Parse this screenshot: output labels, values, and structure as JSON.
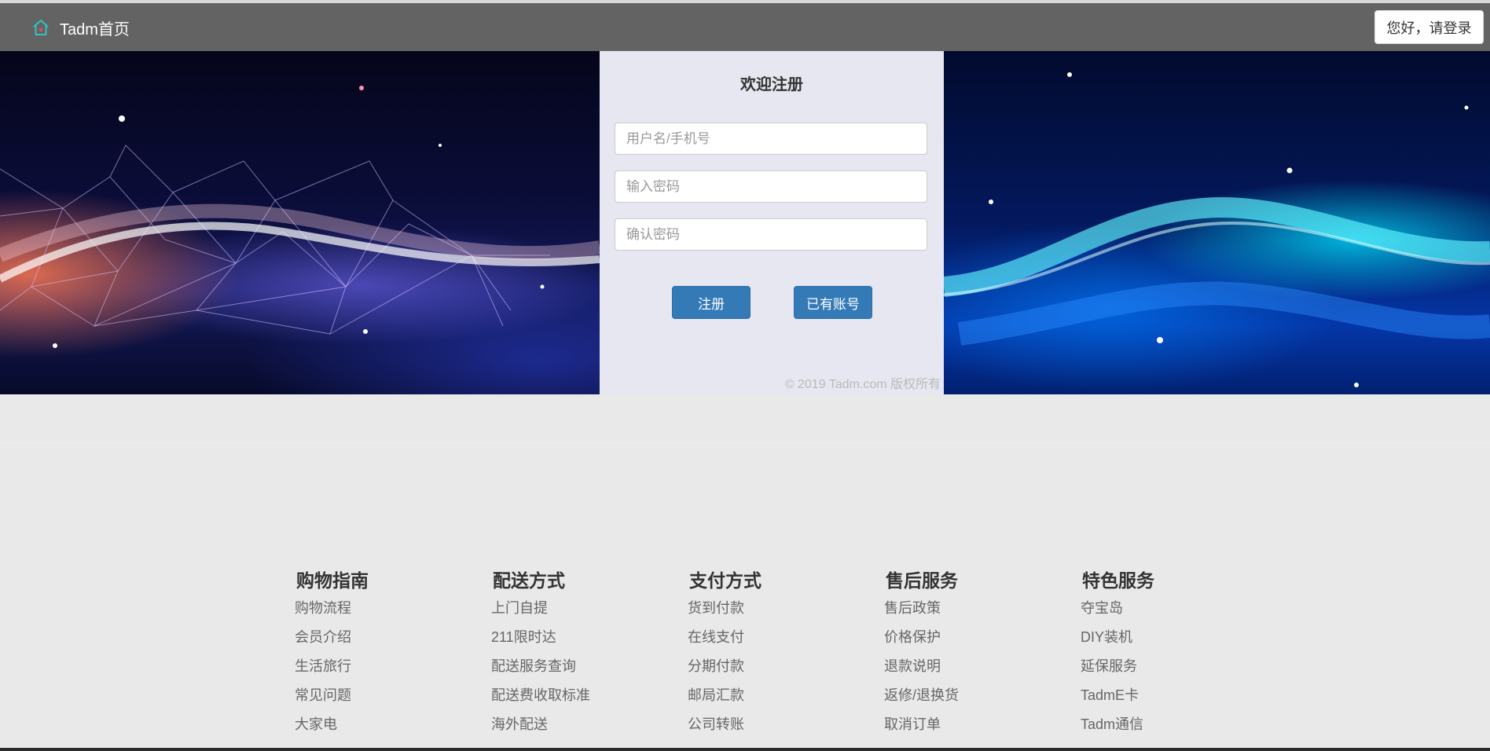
{
  "header": {
    "home_label": "Tadm首页",
    "login_label": "您好，请登录"
  },
  "register": {
    "title": "欢迎注册",
    "username_placeholder": "用户名/手机号",
    "password_placeholder": "输入密码",
    "confirm_placeholder": "确认密码",
    "register_button": "注册",
    "have_account_button": "已有账号",
    "copyright": "© 2019 Tadm.com 版权所有"
  },
  "footer": {
    "columns": [
      {
        "title": "购物指南",
        "items": [
          "购物流程",
          "会员介绍",
          "生活旅行",
          "常见问题",
          "大家电"
        ]
      },
      {
        "title": "配送方式",
        "items": [
          "上门自提",
          "211限时达",
          "配送服务查询",
          "配送费收取标准",
          "海外配送"
        ]
      },
      {
        "title": "支付方式",
        "items": [
          "货到付款",
          "在线支付",
          "分期付款",
          "邮局汇款",
          "公司转账"
        ]
      },
      {
        "title": "售后服务",
        "items": [
          "售后政策",
          "价格保护",
          "退款说明",
          "返修/退换货",
          "取消订单"
        ]
      },
      {
        "title": "特色服务",
        "items": [
          "夺宝岛",
          "DIY装机",
          "延保服务",
          "TadmE卡",
          "Tadm通信"
        ]
      }
    ]
  },
  "colors": {
    "topbar": "#636363",
    "panel": "#e6e7f0",
    "primary_button": "#337ab7",
    "home_icon": "#2ec4c4"
  }
}
